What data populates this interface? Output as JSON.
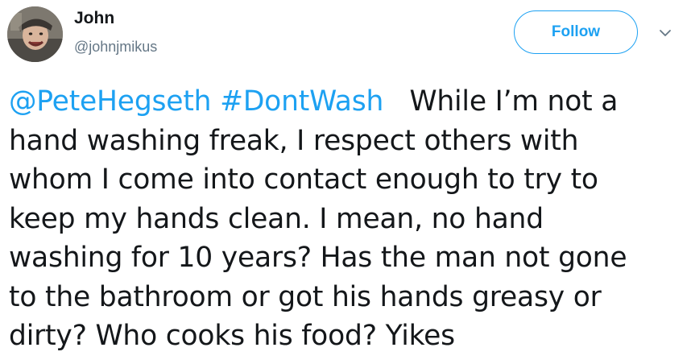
{
  "author": {
    "name": "John",
    "handle": "@johnjmikus"
  },
  "actions": {
    "follow_label": "Follow"
  },
  "tweet": {
    "mention": "@PeteHegseth",
    "hashtag": "#DontWash",
    "lines": [
      "   While I’m not a",
      "hand washing freak, I respect others with",
      "whom I come into contact enough to try to",
      "keep my hands clean. I mean, no hand",
      "washing for 10 years? Has the man not gone",
      "to the bathroom or got his hands greasy or",
      "dirty? Who cooks his food? Yikes"
    ]
  },
  "colors": {
    "link": "#1da1f2",
    "secondary_text": "#657786",
    "text": "#14171a"
  },
  "icons": {
    "avatar": "profile-photo",
    "more": "chevron-down-icon"
  }
}
